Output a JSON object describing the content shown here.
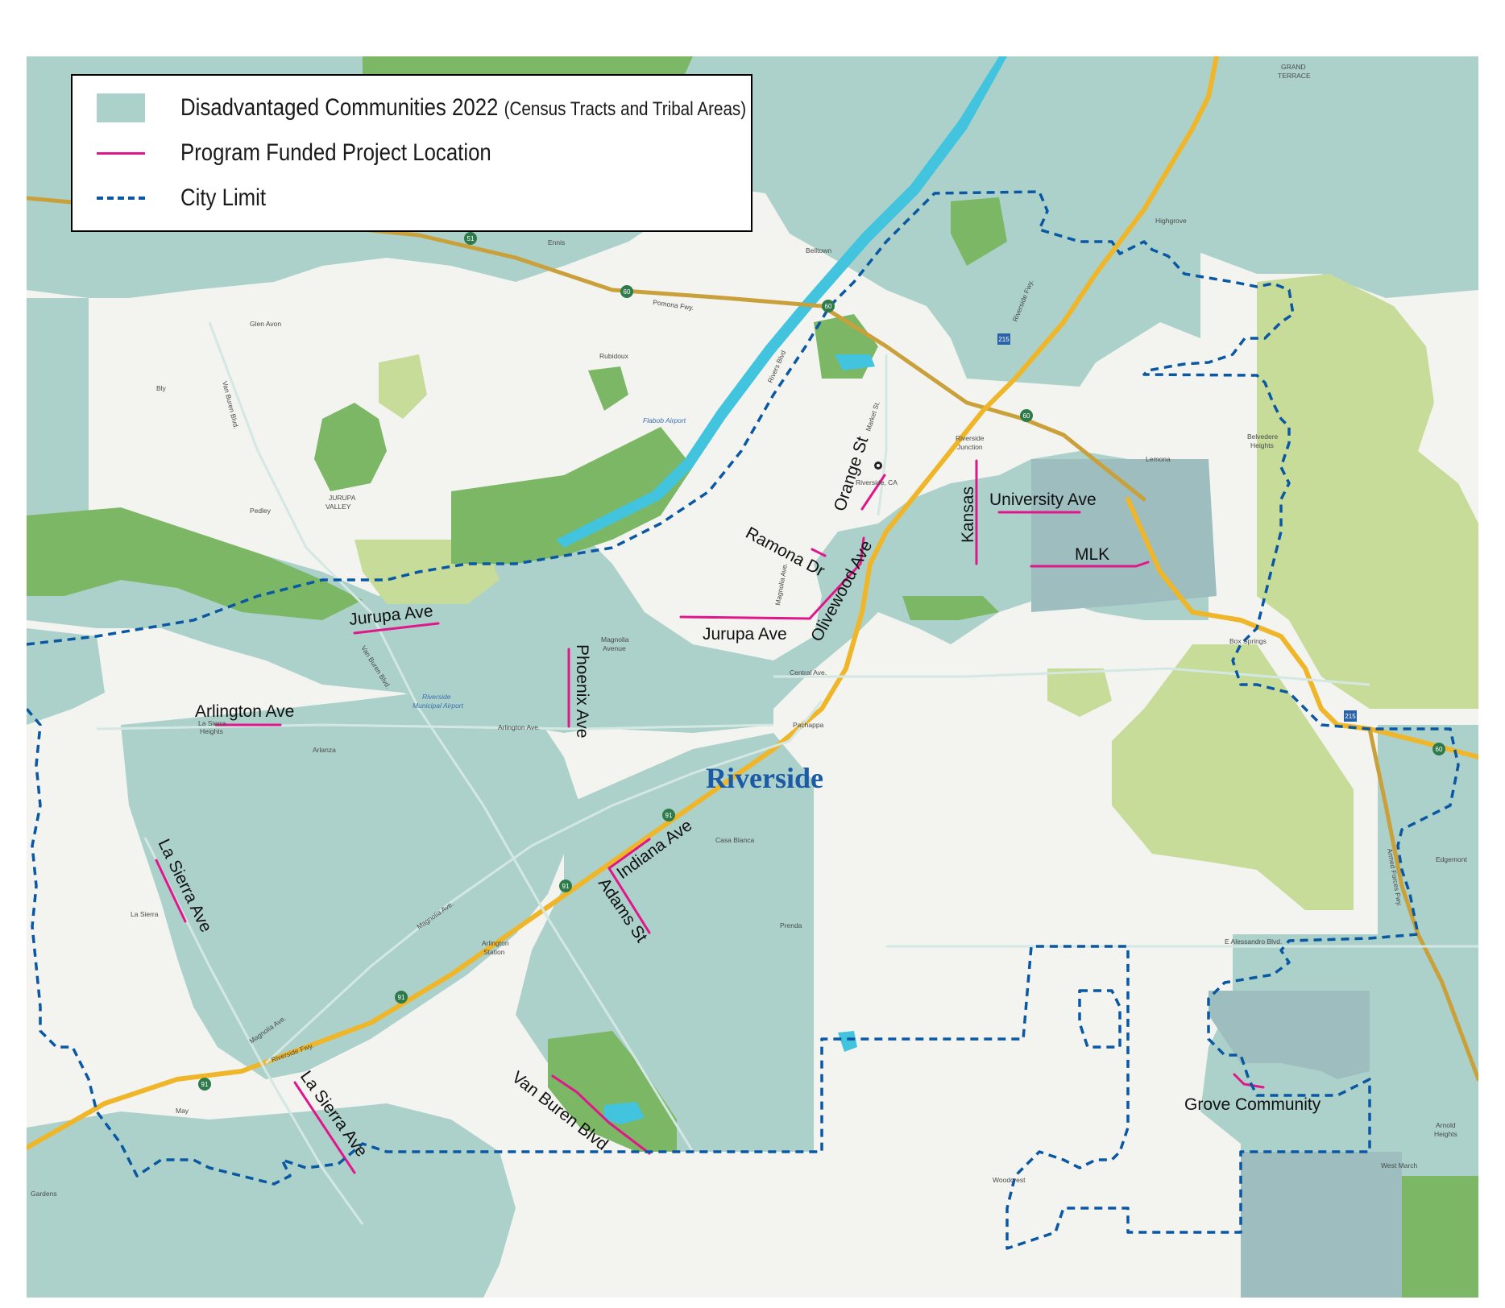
{
  "legend": {
    "dac_label": "Disadvantaged Communities 2022",
    "dac_sub": "(Census Tracts and Tribal Areas)",
    "project_label": "Program Funded Project Location",
    "city_limit_label": "City Limit"
  },
  "colors": {
    "dac": "#acd1ca",
    "base": "#f3f3f0",
    "park_dark": "#7bb765",
    "park_light": "#c8dc9a",
    "water": "#42c4de",
    "freeway": "#f0b62a",
    "highway": "#c9a03a",
    "project": "#e0168a",
    "city_limit": "#0a58a3",
    "tribal": "#9dbdbf"
  },
  "city_name": "Riverside",
  "project_labels": {
    "orange_st": "Orange St",
    "university_ave": "University Ave",
    "kansas": "Kansas",
    "ramona_dr": "Ramona Dr",
    "olivewood_ave": "Olivewood Ave",
    "mlk": "MLK",
    "jurupa_ave_w": "Jurupa Ave",
    "jurupa_ave_e": "Jurupa Ave",
    "phoenix_ave": "Phoenix Ave",
    "arlington_ave": "Arlington Ave",
    "la_sierra_ave_n": "La Sierra Ave",
    "indiana_ave": "Indiana Ave",
    "adams_st": "Adams St",
    "la_sierra_ave_s": "La Sierra Ave",
    "van_buren_blvd": "Van Buren Blvd",
    "grove_community": "Grove Community"
  },
  "place_labels": {
    "grand_terrace_1": "GRAND",
    "grand_terrace_2": "TERRACE",
    "highgrove": "Highgrove",
    "belltown": "Belltown",
    "ennis": "Ennis",
    "glen_avon": "Glen Avon",
    "rubidoux": "Rubidoux",
    "bly": "Bly",
    "flabob_airport": "Flabob Airport",
    "jurupa_valley_1": "JURUPA",
    "jurupa_valley_2": "VALLEY",
    "pedley": "Pedley",
    "riverside_ca": "Riverside, CA",
    "riverside_junction_1": "Riverside",
    "riverside_junction_2": "Junction",
    "lemona": "Lemona",
    "belvedere_1": "Belvedere",
    "belvedere_2": "Heights",
    "box_springs": "Box Springs",
    "magnolia_avenue_1": "Magnolia",
    "magnolia_avenue_2": "Avenue",
    "central_ave": "Central Ave.",
    "pachappa": "Pachappa",
    "arlington_ave_st": "Arlington Ave.",
    "la_sierra_heights_1": "La Sierra",
    "la_sierra_heights_2": "Heights",
    "arlanza": "Arlanza",
    "casa_blanca": "Casa Blanca",
    "la_sierra": "La Sierra",
    "arlington_station_1": "Arlington",
    "arlington_station_2": "Station",
    "prenda": "Prenda",
    "edgemont": "Edgemont",
    "e_alessandro": "E Alessandro Blvd.",
    "may": "May",
    "gardens": "Gardens",
    "woodcrest": "Woodcrest",
    "west_march": "West March",
    "arnold_heights_1": "Arnold",
    "arnold_heights_2": "Heights",
    "riverside_municipal_1": "Riverside",
    "riverside_municipal_2": "Municipal Airport",
    "riverside_fwy": "Riverside Fwy.",
    "pomona_fwy": "Pomona Fwy.",
    "van_buren_st": "Van Buren Blvd.",
    "van_buren_north": "Van Buren Blvd.",
    "magnolia_ave_sw": "Magnolia Ave.",
    "magnolia_ave_mid": "Magnolia Ave.",
    "magnolia_ave_n": "Magnolia Ave.",
    "market_st": "Market St.",
    "riverside_fwy_n": "Riverside Fwy.",
    "armed_forces": "Armed Forces Fwy.",
    "rivers_blvd": "Rivers Blvd"
  },
  "shields": {
    "r60_a": "60",
    "r60_b": "60",
    "r60_c": "60",
    "r60_d": "60",
    "r91_a": "91",
    "r91_b": "91",
    "r91_c": "91",
    "r91_d": "91",
    "i215_a": "215",
    "i215_b": "215",
    "r51": "51"
  }
}
